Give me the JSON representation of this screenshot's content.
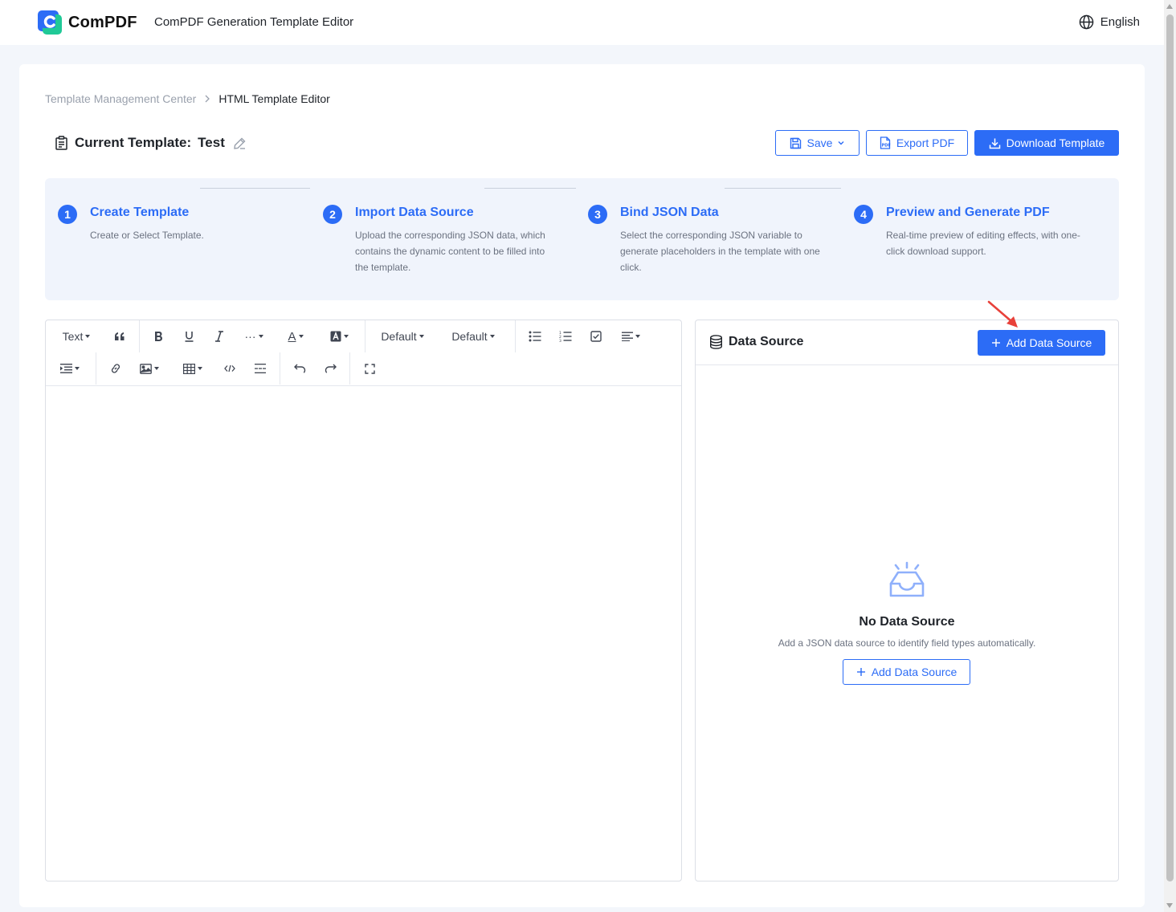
{
  "header": {
    "logo_text": "ComPDF",
    "app_title": "ComPDF Generation Template Editor",
    "language": "English"
  },
  "breadcrumb": {
    "parent": "Template Management Center",
    "separator": ">",
    "current": "HTML Template Editor"
  },
  "template": {
    "label": "Current Template:",
    "name": "Test"
  },
  "actions": {
    "save": "Save",
    "export": "Export PDF",
    "download": "Download Template"
  },
  "steps": [
    {
      "num": "1",
      "title": "Create Template",
      "desc": "Create or Select Template."
    },
    {
      "num": "2",
      "title": "Import Data Source",
      "desc": "Upload the corresponding JSON data, which contains the dynamic content to be filled into the template."
    },
    {
      "num": "3",
      "title": "Bind JSON Data",
      "desc": "Select the corresponding JSON variable to generate placeholders in the template with one click."
    },
    {
      "num": "4",
      "title": "Preview and Generate PDF",
      "desc": "Real-time preview of editing effects, with one-click download support."
    }
  ],
  "toolbar": {
    "text_style": "Text",
    "font_family": "Default",
    "font_size": "Default",
    "more": "···",
    "font_color_glyph": "A"
  },
  "data_source": {
    "title": "Data Source",
    "add_button": "Add Data Source",
    "empty_title": "No Data Source",
    "empty_desc": "Add a JSON data source to identify field types automatically.",
    "empty_add_button": "Add Data Source"
  },
  "colors": {
    "primary": "#2c6cf6",
    "annotation_arrow": "#e8413a"
  }
}
